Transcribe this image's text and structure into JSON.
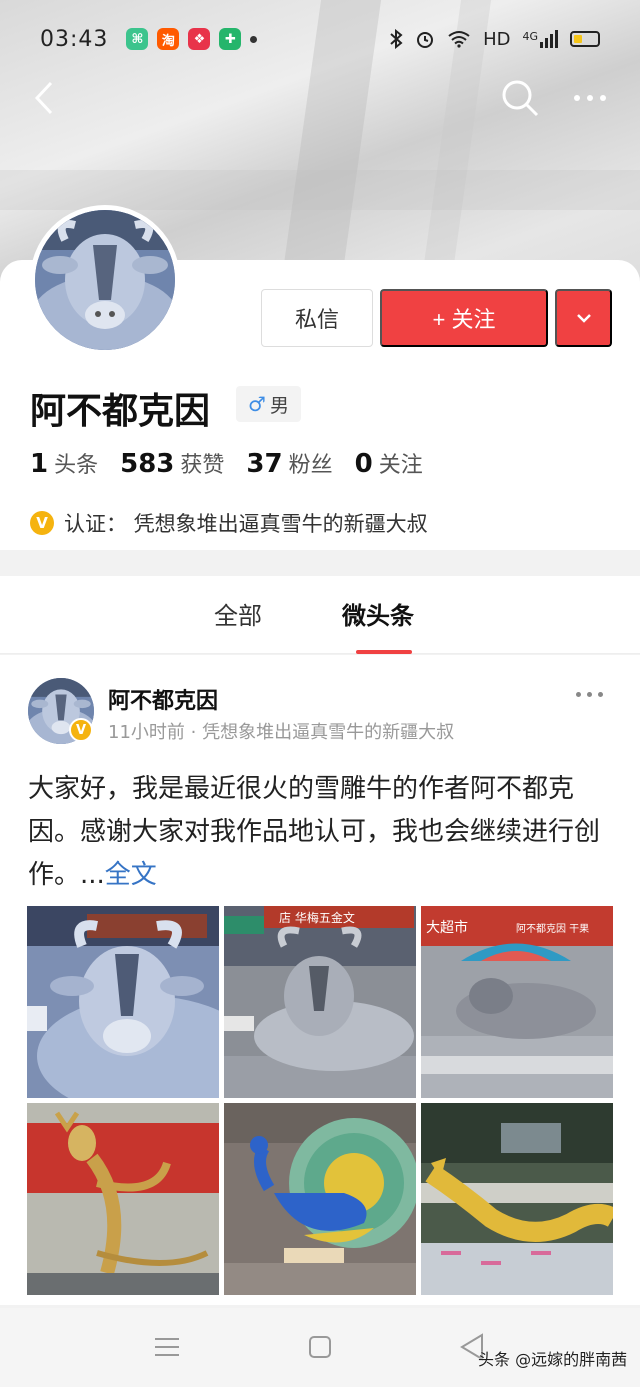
{
  "status_bar": {
    "time": "03:43",
    "notif_icons": [
      {
        "name": "app-green-icon",
        "color": "#3cc48d",
        "glyph": "⌘"
      },
      {
        "name": "taobao-icon",
        "color": "#ff5a00",
        "glyph": "淘"
      },
      {
        "name": "app-red-icon",
        "color": "#e8334a",
        "glyph": "❖"
      },
      {
        "name": "shield-app-icon",
        "color": "#25b56b",
        "glyph": "✚"
      }
    ],
    "network_label": "HD",
    "signal_label": "4G"
  },
  "profile": {
    "name": "阿不都克因",
    "gender_symbol": "♂",
    "gender_label": "男",
    "message_button": "私信",
    "follow_button": "+ 关注",
    "stats": [
      {
        "num": "1",
        "label": "头条"
      },
      {
        "num": "583",
        "label": "获赞"
      },
      {
        "num": "37",
        "label": "粉丝"
      },
      {
        "num": "0",
        "label": "关注"
      }
    ],
    "verify_badge": "V",
    "verify_text": "认证：  凭想象堆出逼真雪牛的新疆大叔"
  },
  "tabs": [
    {
      "label": "全部",
      "active": false
    },
    {
      "label": "微头条",
      "active": true
    }
  ],
  "post": {
    "author": "阿不都克因",
    "meta": "11小时前 · 凭想象堆出逼真雪牛的新疆大叔",
    "text": "大家好，我是最近很火的雪雕牛的作者阿不都克因。感谢大家对我作品地认可，我也会继续进行创作。...",
    "full_link": "全文",
    "images": [
      {
        "name": "snow-bull-closeup-image"
      },
      {
        "name": "snow-bull-street-image"
      },
      {
        "name": "snow-bull-market-image"
      },
      {
        "name": "sculpture-deer-image"
      },
      {
        "name": "peacock-sculpture-image"
      },
      {
        "name": "golden-dragon-sculpture-image"
      }
    ],
    "sign_texts": [
      "店 华梅五金文",
      "大超市",
      "阿不都克因 干果"
    ]
  },
  "watermark": "头条 @远嫁的胖南茜",
  "colors": {
    "accent_red": "#f04142",
    "link_blue": "#3674c5",
    "verify_gold": "#f5b30f"
  }
}
